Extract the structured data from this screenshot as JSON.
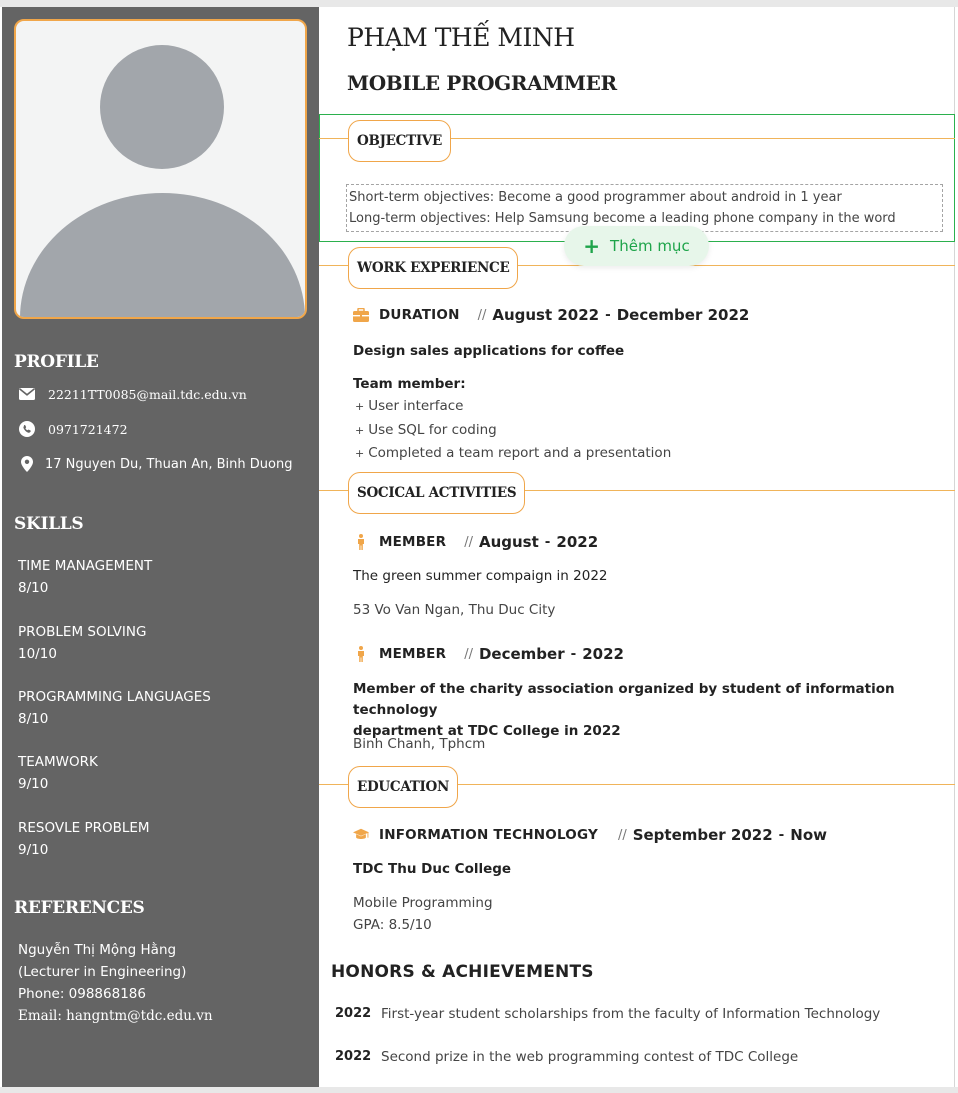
{
  "name": "PHẠM THẾ MINH",
  "job_title": "MOBILE PROGRAMMER",
  "sidebar": {
    "profile_heading": "PROFILE",
    "email": "22211TT0085@mail.tdc.edu.vn",
    "phone": "0971721472",
    "address": "17 Nguyen Du, Thuan An, Binh Duong",
    "skills_heading": "SKILLS",
    "skills": [
      {
        "name": "TIME MANAGEMENT",
        "score": "8/10"
      },
      {
        "name": "PROBLEM SOLVING",
        "score": "10/10"
      },
      {
        "name": "PROGRAMMING LANGUAGES",
        "score": "8/10"
      },
      {
        "name": "TEAMWORK",
        "score": "9/10"
      },
      {
        "name": "RESOVLE PROBLEM",
        "score": "9/10"
      }
    ],
    "references_heading": "REFERENCES",
    "references": {
      "name": "Nguyễn Thị Mộng Hằng",
      "role": "(Lecturer in Engineering)",
      "phone": "Phone: 098868186",
      "email": "Email: hangntm@tdc.edu.vn"
    }
  },
  "objective": {
    "title": "OBJECTIVE",
    "short_term": "Short-term objectives: Become a good programmer about android in 1 year",
    "long_term": "Long-term objectives: Help Samsung become a leading phone company in the word",
    "add_button": "Thêm mục"
  },
  "work": {
    "title": "WORK EXPERIENCE",
    "label": "DURATION",
    "sep": "//",
    "start": "August 2022",
    "dash": "-",
    "end": "December 2022",
    "project": "Design sales applications for coffee",
    "team_label": "Team member:",
    "items": [
      "User interface",
      "Use SQL for coding",
      "Completed a team report and a presentation"
    ],
    "bullet": "+"
  },
  "social": {
    "title": "SOCICAL ACTIVITIES",
    "entries": [
      {
        "role": "MEMBER",
        "month": "August",
        "year": "2022",
        "desc": "The green summer compaign in 2022",
        "place": "53 Vo Van Ngan, Thu Duc City"
      },
      {
        "role": "MEMBER",
        "month": "December",
        "year": "2022",
        "desc": "Member of the charity association organized by student of information technology",
        "desc2": "department at TDC College in 2022",
        "place": "Binh Chanh, Tphcm"
      }
    ]
  },
  "education": {
    "title": "EDUCATION",
    "major": "INFORMATION TECHNOLOGY",
    "start": "September 2022",
    "end": "Now",
    "school": "TDC Thu Duc College",
    "program": "Mobile Programming",
    "gpa": "GPA: 8.5/10"
  },
  "honors": {
    "title": "HONORS & ACHIEVEMENTS",
    "items": [
      {
        "year": "2022",
        "text": "First-year student scholarships from the faculty of Information Technology"
      },
      {
        "year": "2022",
        "text": "Second prize in the web programming contest of TDC College"
      }
    ]
  },
  "colors": {
    "accent": "#f0a64a",
    "sidebar": "#646464",
    "green": "#2bb04d"
  }
}
